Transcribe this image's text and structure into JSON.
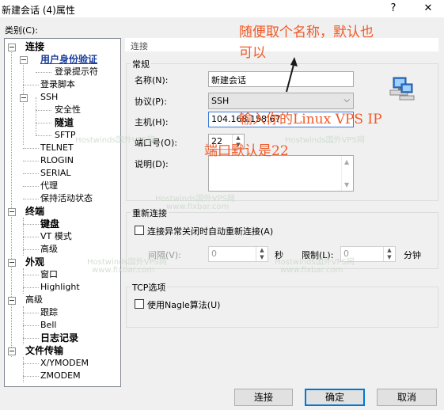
{
  "window": {
    "title": "新建会话 (4)属性",
    "help_btn": "?",
    "close_btn": "✕"
  },
  "category_label": "类别(C):",
  "tree": {
    "items": [
      {
        "label": "连接"
      },
      {
        "label": "用户身份验证"
      },
      {
        "label": "登录提示符"
      },
      {
        "label": "登录脚本"
      },
      {
        "label": "SSH"
      },
      {
        "label": "安全性"
      },
      {
        "label": "隧道"
      },
      {
        "label": "SFTP"
      },
      {
        "label": "TELNET"
      },
      {
        "label": "RLOGIN"
      },
      {
        "label": "SERIAL"
      },
      {
        "label": "代理"
      },
      {
        "label": "保持活动状态"
      },
      {
        "label": "终端"
      },
      {
        "label": "键盘"
      },
      {
        "label": "VT 模式"
      },
      {
        "label": "高级"
      },
      {
        "label": "外观"
      },
      {
        "label": "窗口"
      },
      {
        "label": "Highlight"
      },
      {
        "label": "高级"
      },
      {
        "label": "跟踪"
      },
      {
        "label": "Bell"
      },
      {
        "label": "日志记录"
      },
      {
        "label": "文件传输"
      },
      {
        "label": "X/YMODEM"
      },
      {
        "label": "ZMODEM"
      }
    ]
  },
  "panel": {
    "title": "连接",
    "general": {
      "legend": "常规",
      "name_label": "名称(N):",
      "name_value": "新建会话",
      "protocol_label": "协议(P):",
      "protocol_value": "SSH",
      "host_label": "主机(H):",
      "host_value": "104.168.158.67",
      "port_label": "端口号(O):",
      "port_value": "22",
      "desc_label": "说明(D):"
    },
    "reconnect": {
      "legend": "重新连接",
      "auto_reconnect_label": "连接异常关闭时自动重新连接(A)",
      "interval_label": "间隔(V):",
      "interval_value": "0",
      "seconds_label": "秒",
      "limit_label": "限制(L):",
      "limit_value": "0",
      "minutes_label": "分钟"
    },
    "tcp": {
      "legend": "TCP选项",
      "nagle_label": "使用Nagle算法(U)"
    }
  },
  "buttons": {
    "connect": "连接",
    "ok": "确定",
    "cancel": "取消"
  },
  "annotations": {
    "line1": "随便取个名称，默认也",
    "line2": "可以",
    "host_note": "输入你的Linux VPS IP",
    "port_note": "端口默认是22",
    "color": "#f05a28"
  },
  "watermarks": {
    "brand": "Hostwinds国外VPS网",
    "url": "www.fixbar.com"
  }
}
